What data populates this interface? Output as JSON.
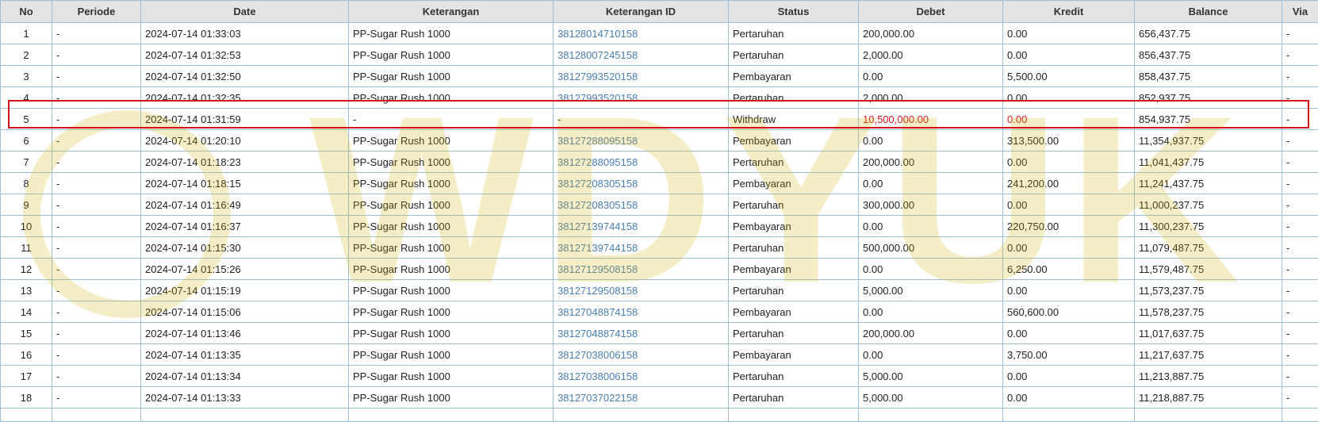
{
  "columns": [
    "No",
    "Periode",
    "Date",
    "Keterangan",
    "Keterangan ID",
    "Status",
    "Debet",
    "Kredit",
    "Balance",
    "Via"
  ],
  "rows": [
    {
      "no": "1",
      "periode": "-",
      "date": "2024-07-14 01:33:03",
      "keterangan": "PP-Sugar Rush 1000",
      "ket_id": "38128014710158",
      "status": "Pertaruhan",
      "debet": "200,000.00",
      "kredit": "0.00",
      "balance": "656,437.75",
      "via": "-"
    },
    {
      "no": "2",
      "periode": "-",
      "date": "2024-07-14 01:32:53",
      "keterangan": "PP-Sugar Rush 1000",
      "ket_id": "38128007245158",
      "status": "Pertaruhan",
      "debet": "2,000.00",
      "kredit": "0.00",
      "balance": "856,437.75",
      "via": "-"
    },
    {
      "no": "3",
      "periode": "-",
      "date": "2024-07-14 01:32:50",
      "keterangan": "PP-Sugar Rush 1000",
      "ket_id": "38127993520158",
      "status": "Pembayaran",
      "debet": "0.00",
      "kredit": "5,500.00",
      "balance": "858,437.75",
      "via": "-"
    },
    {
      "no": "4",
      "periode": "-",
      "date": "2024-07-14 01:32:35",
      "keterangan": "PP-Sugar Rush 1000",
      "ket_id": "38127993520158",
      "status": "Pertaruhan",
      "debet": "2,000.00",
      "kredit": "0.00",
      "balance": "852,937.75",
      "via": "-"
    },
    {
      "no": "5",
      "periode": "-",
      "date": "2024-07-14 01:31:59",
      "keterangan": "-",
      "ket_id": "-",
      "status": "Withdraw",
      "debet": "10,500,000.00",
      "kredit": "0.00",
      "balance": "854,937.75",
      "via": "-"
    },
    {
      "no": "6",
      "periode": "-",
      "date": "2024-07-14 01:20:10",
      "keterangan": "PP-Sugar Rush 1000",
      "ket_id": "38127288095158",
      "status": "Pembayaran",
      "debet": "0.00",
      "kredit": "313,500.00",
      "balance": "11,354,937.75",
      "via": "-"
    },
    {
      "no": "7",
      "periode": "-",
      "date": "2024-07-14 01:18:23",
      "keterangan": "PP-Sugar Rush 1000",
      "ket_id": "38127288095158",
      "status": "Pertaruhan",
      "debet": "200,000.00",
      "kredit": "0.00",
      "balance": "11,041,437.75",
      "via": "-"
    },
    {
      "no": "8",
      "periode": "-",
      "date": "2024-07-14 01:18:15",
      "keterangan": "PP-Sugar Rush 1000",
      "ket_id": "38127208305158",
      "status": "Pembayaran",
      "debet": "0.00",
      "kredit": "241,200.00",
      "balance": "11,241,437.75",
      "via": "-"
    },
    {
      "no": "9",
      "periode": "-",
      "date": "2024-07-14 01:16:49",
      "keterangan": "PP-Sugar Rush 1000",
      "ket_id": "38127208305158",
      "status": "Pertaruhan",
      "debet": "300,000.00",
      "kredit": "0.00",
      "balance": "11,000,237.75",
      "via": "-"
    },
    {
      "no": "10",
      "periode": "-",
      "date": "2024-07-14 01:16:37",
      "keterangan": "PP-Sugar Rush 1000",
      "ket_id": "38127139744158",
      "status": "Pembayaran",
      "debet": "0.00",
      "kredit": "220,750.00",
      "balance": "11,300,237.75",
      "via": "-"
    },
    {
      "no": "11",
      "periode": "-",
      "date": "2024-07-14 01:15:30",
      "keterangan": "PP-Sugar Rush 1000",
      "ket_id": "38127139744158",
      "status": "Pertaruhan",
      "debet": "500,000.00",
      "kredit": "0.00",
      "balance": "11,079,487.75",
      "via": "-"
    },
    {
      "no": "12",
      "periode": "-",
      "date": "2024-07-14 01:15:26",
      "keterangan": "PP-Sugar Rush 1000",
      "ket_id": "38127129508158",
      "status": "Pembayaran",
      "debet": "0.00",
      "kredit": "6,250.00",
      "balance": "11,579,487.75",
      "via": "-"
    },
    {
      "no": "13",
      "periode": "-",
      "date": "2024-07-14 01:15:19",
      "keterangan": "PP-Sugar Rush 1000",
      "ket_id": "38127129508158",
      "status": "Pertaruhan",
      "debet": "5,000.00",
      "kredit": "0.00",
      "balance": "11,573,237.75",
      "via": "-"
    },
    {
      "no": "14",
      "periode": "-",
      "date": "2024-07-14 01:15:06",
      "keterangan": "PP-Sugar Rush 1000",
      "ket_id": "38127048874158",
      "status": "Pembayaran",
      "debet": "0.00",
      "kredit": "560,600.00",
      "balance": "11,578,237.75",
      "via": "-"
    },
    {
      "no": "15",
      "periode": "-",
      "date": "2024-07-14 01:13:46",
      "keterangan": "PP-Sugar Rush 1000",
      "ket_id": "38127048874158",
      "status": "Pertaruhan",
      "debet": "200,000.00",
      "kredit": "0.00",
      "balance": "11,017,637.75",
      "via": "-"
    },
    {
      "no": "16",
      "periode": "-",
      "date": "2024-07-14 01:13:35",
      "keterangan": "PP-Sugar Rush 1000",
      "ket_id": "38127038006158",
      "status": "Pembayaran",
      "debet": "0.00",
      "kredit": "3,750.00",
      "balance": "11,217,637.75",
      "via": "-"
    },
    {
      "no": "17",
      "periode": "-",
      "date": "2024-07-14 01:13:34",
      "keterangan": "PP-Sugar Rush 1000",
      "ket_id": "38127038006158",
      "status": "Pertaruhan",
      "debet": "5,000.00",
      "kredit": "0.00",
      "balance": "11,213,887.75",
      "via": "-"
    },
    {
      "no": "18",
      "periode": "-",
      "date": "2024-07-14 01:13:33",
      "keterangan": "PP-Sugar Rush 1000",
      "ket_id": "38127037022158",
      "status": "Pertaruhan",
      "debet": "5,000.00",
      "kredit": "0.00",
      "balance": "11,218,887.75",
      "via": "-"
    }
  ],
  "highlighted_row_no": "5",
  "watermark_text": "WDYUK",
  "colors": {
    "link": "#4a7fb5",
    "negative": "#d9181e",
    "highlight_border": "#d0121a",
    "grid": "#9cc0dc",
    "header_bg": "#e4e4e4",
    "watermark": "#d4b000"
  }
}
